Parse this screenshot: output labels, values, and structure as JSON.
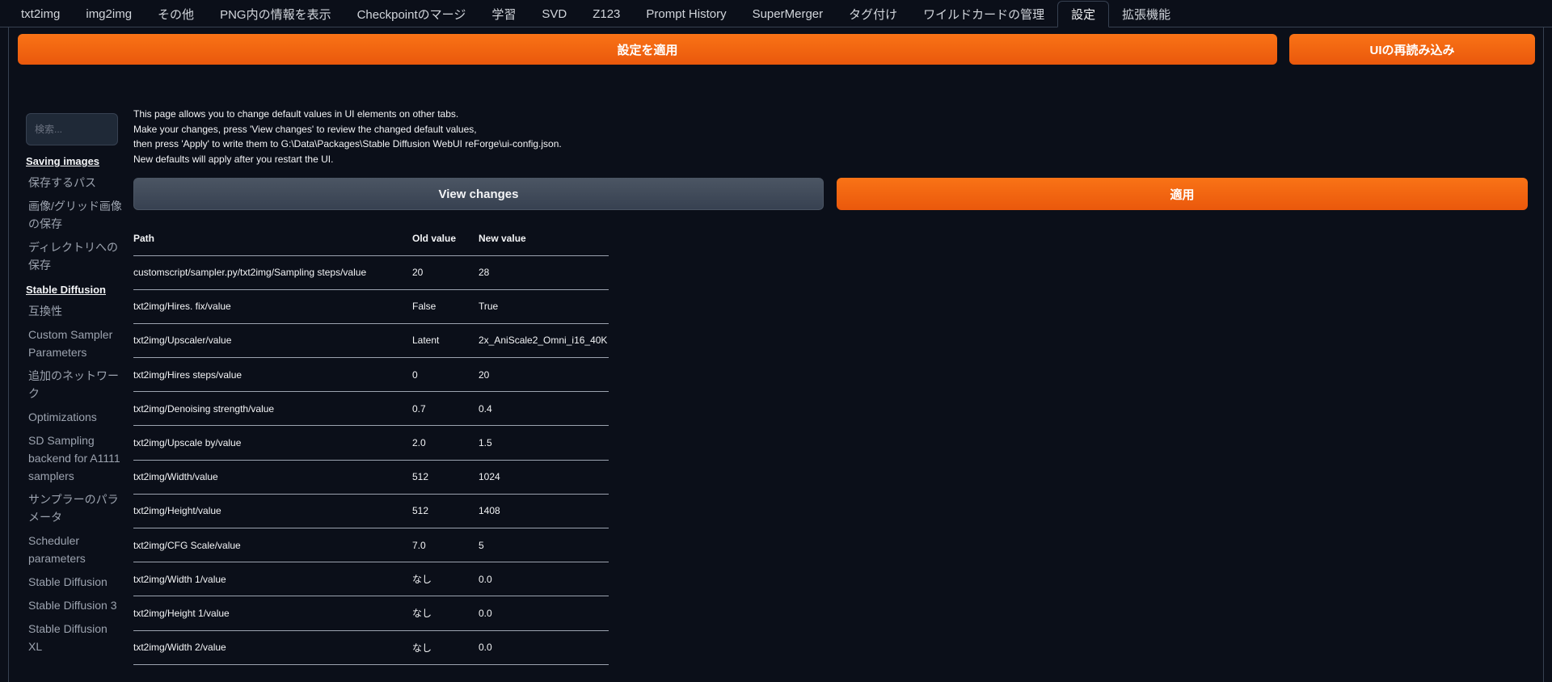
{
  "tabs": [
    {
      "label": "txt2img",
      "active": false
    },
    {
      "label": "img2img",
      "active": false
    },
    {
      "label": "その他",
      "active": false
    },
    {
      "label": "PNG内の情報を表示",
      "active": false
    },
    {
      "label": "Checkpointのマージ",
      "active": false
    },
    {
      "label": "学習",
      "active": false
    },
    {
      "label": "SVD",
      "active": false
    },
    {
      "label": "Z123",
      "active": false
    },
    {
      "label": "Prompt History",
      "active": false
    },
    {
      "label": "SuperMerger",
      "active": false
    },
    {
      "label": "タグ付け",
      "active": false
    },
    {
      "label": "ワイルドカードの管理",
      "active": false
    },
    {
      "label": "設定",
      "active": true
    },
    {
      "label": "拡張機能",
      "active": false
    }
  ],
  "toolbar": {
    "apply_settings_label": "設定を適用",
    "reload_ui_label": "UIの再読み込み"
  },
  "search": {
    "placeholder": "検索..."
  },
  "sidebar": {
    "sections": [
      {
        "title": "Saving images",
        "items": [
          "保存するパス",
          "画像/グリッド画像の保存",
          "ディレクトリへの保存"
        ]
      },
      {
        "title": "Stable Diffusion",
        "items": [
          "互換性",
          "Custom Sampler Parameters",
          "追加のネットワーク",
          "Optimizations",
          "SD Sampling backend for A1111 samplers",
          "サンプラーのパラメータ",
          "Scheduler parameters",
          "Stable Diffusion",
          "Stable Diffusion 3",
          "Stable Diffusion XL"
        ]
      }
    ]
  },
  "description": {
    "line1": "This page allows you to change default values in UI elements on other tabs.",
    "line2": "Make your changes, press 'View changes' to review the changed default values,",
    "line3": "then press 'Apply' to write them to G:\\Data\\Packages\\Stable Diffusion WebUI reForge\\ui-config.json.",
    "line4": "New defaults will apply after you restart the UI."
  },
  "actions": {
    "view_changes_label": "View changes",
    "apply_label": "適用"
  },
  "table": {
    "headers": {
      "path": "Path",
      "old": "Old value",
      "new": "New value"
    },
    "rows": [
      {
        "path": "customscript/sampler.py/txt2img/Sampling steps/value",
        "old": "20",
        "new": "28"
      },
      {
        "path": "txt2img/Hires. fix/value",
        "old": "False",
        "new": "True"
      },
      {
        "path": "txt2img/Upscaler/value",
        "old": "Latent",
        "new": "2x_AniScale2_Omni_i16_40K"
      },
      {
        "path": "txt2img/Hires steps/value",
        "old": "0",
        "new": "20"
      },
      {
        "path": "txt2img/Denoising strength/value",
        "old": "0.7",
        "new": "0.4"
      },
      {
        "path": "txt2img/Upscale by/value",
        "old": "2.0",
        "new": "1.5"
      },
      {
        "path": "txt2img/Width/value",
        "old": "512",
        "new": "1024"
      },
      {
        "path": "txt2img/Height/value",
        "old": "512",
        "new": "1408"
      },
      {
        "path": "txt2img/CFG Scale/value",
        "old": "7.0",
        "new": "5"
      },
      {
        "path": "txt2img/Width 1/value",
        "old": "なし",
        "new": "0.0"
      },
      {
        "path": "txt2img/Height 1/value",
        "old": "なし",
        "new": "0.0"
      },
      {
        "path": "txt2img/Width 2/value",
        "old": "なし",
        "new": "0.0"
      }
    ]
  },
  "colors": {
    "accent": "#f97316",
    "background": "#0b0f19",
    "panel": "#1f2937"
  }
}
